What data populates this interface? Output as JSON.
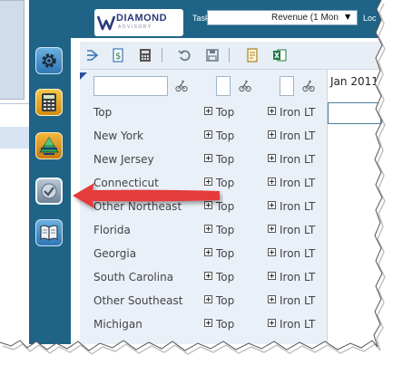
{
  "header": {
    "logo_name": "DIAMOND",
    "logo_sub": "ADVISORY",
    "task_label": "Task",
    "task_select_value": "Revenue (1 Mon",
    "location_label": "Loc"
  },
  "rail": {
    "buttons": [
      {
        "icon": "gear-icon"
      },
      {
        "icon": "calculator-icon"
      },
      {
        "icon": "pyramid-icon"
      },
      {
        "icon": "checkmark-icon",
        "highlighted": true
      },
      {
        "icon": "book-icon"
      }
    ]
  },
  "toolbar": {
    "icons": [
      "share-icon",
      "document-dollar-icon",
      "calculator-icon",
      "undo-icon",
      "save-icon",
      "page-icon",
      "excel-icon"
    ]
  },
  "grid": {
    "column_header": "Jan 2011",
    "rows": [
      {
        "region": "Top",
        "level1": "Top",
        "level2": "Iron LT"
      },
      {
        "region": "New York",
        "level1": "Top",
        "level2": "Iron LT"
      },
      {
        "region": "New Jersey",
        "level1": "Top",
        "level2": "Iron LT"
      },
      {
        "region": "Connecticut",
        "level1": "Top",
        "level2": "Iron LT"
      },
      {
        "region": "Other Northeast",
        "level1": "Top",
        "level2": "Iron LT"
      },
      {
        "region": "Florida",
        "level1": "Top",
        "level2": "Iron LT"
      },
      {
        "region": "Georgia",
        "level1": "Top",
        "level2": "Iron LT"
      },
      {
        "region": "South Carolina",
        "level1": "Top",
        "level2": "Iron LT"
      },
      {
        "region": "Other Southeast",
        "level1": "Top",
        "level2": "Iron LT"
      },
      {
        "region": "Michigan",
        "level1": "Top",
        "level2": "Iron LT"
      }
    ]
  },
  "colors": {
    "rail": "#1f6487",
    "grid_bg": "#eaf0f8",
    "arrow": "#e53a3a"
  }
}
